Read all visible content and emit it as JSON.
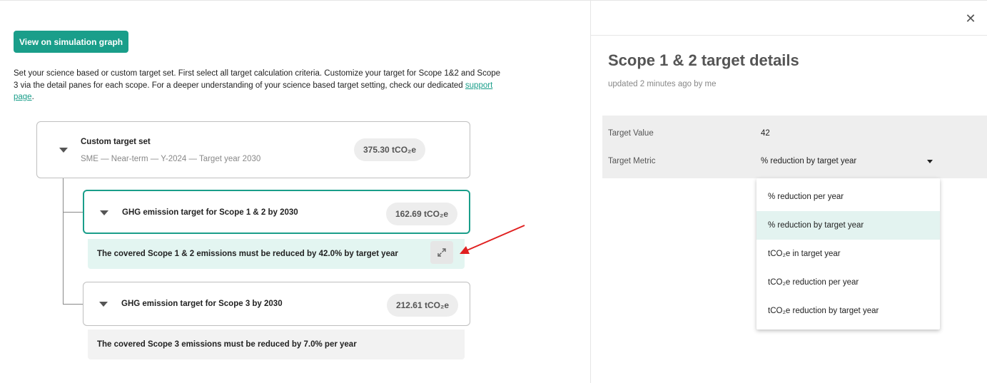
{
  "left": {
    "sim_button": "View on simulation graph",
    "intro_text": "Set your science based or custom target set. First select all target calculation criteria. Customize your target for Scope 1&2 and Scope 3 via the detail panes for each scope. For a deeper understanding of your science based target setting, check our dedicated ",
    "intro_link": "support page",
    "intro_end": ".",
    "root": {
      "title": "Custom target set",
      "subtitle": "SME — Near-term — Y-2024 — Target year 2030",
      "value": "375.30 tCO₂e"
    },
    "scope12": {
      "title": "GHG emission target for Scope 1 & 2 by 2030",
      "value": "162.69 tCO₂e",
      "note": "The covered Scope 1 & 2 emissions must be reduced by 42.0% by target year"
    },
    "scope3": {
      "title": "GHG emission target for Scope 3 by 2030",
      "value": "212.61 tCO₂e",
      "note": "The covered Scope 3 emissions must be reduced by 7.0% per year"
    }
  },
  "right": {
    "title": "Scope 1 & 2 target details",
    "subtitle": "updated 2 minutes ago by me",
    "target_value_label": "Target Value",
    "target_value": "42",
    "target_metric_label": "Target Metric",
    "target_metric": "% reduction by target year",
    "options": [
      "% reduction per year",
      "% reduction by target year",
      "tCO₂e in target year",
      "tCO₂e reduction per year",
      "tCO₂e reduction by target year"
    ],
    "selected_option": "% reduction by target year"
  },
  "colors": {
    "accent": "#1a9e8a",
    "annotation_arrow": "#e02020"
  },
  "icons": {
    "expand": "expand-icon",
    "close": "close-icon",
    "caret": "caret-down-icon"
  }
}
